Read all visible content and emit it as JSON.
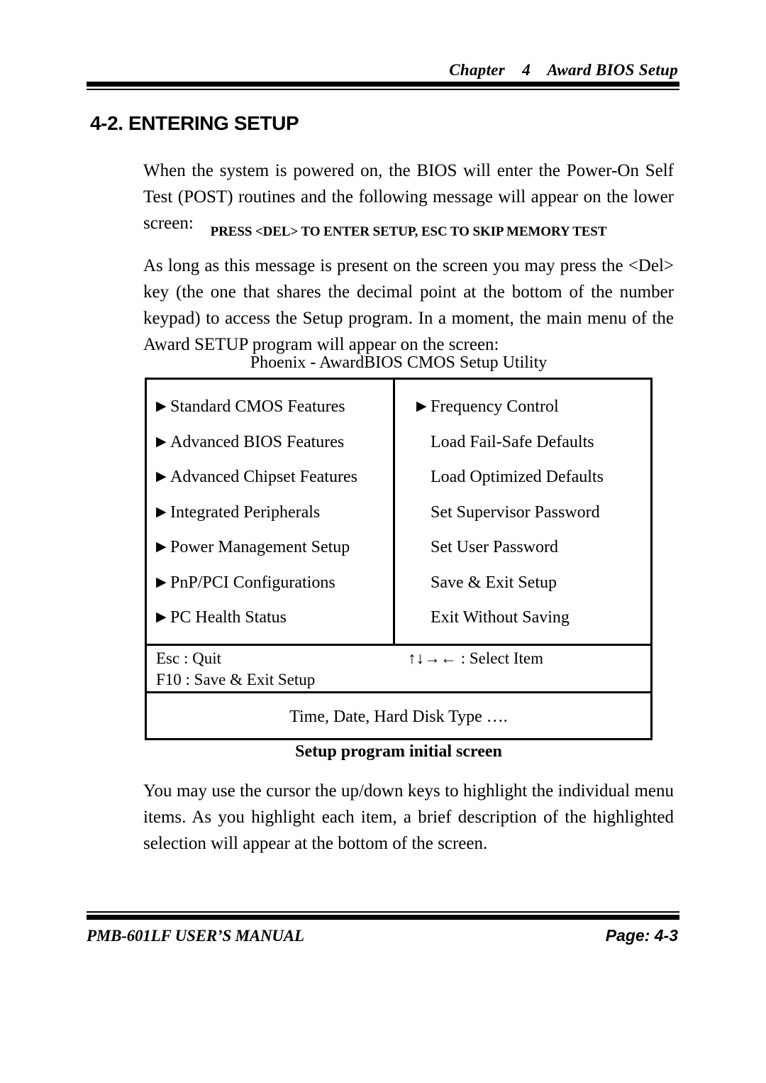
{
  "header": {
    "chapter_label": "Chapter",
    "chapter_number": "4",
    "chapter_title": "Award BIOS Setup",
    "full_title": "Chapter    4    Award BIOS Setup"
  },
  "section": {
    "heading": "4-2. ENTERING SETUP"
  },
  "body": {
    "paragraph_1": "When the system is powered on, the BIOS will enter the Power-On Self Test (POST) routines and the following message will appear on the lower screen:",
    "post_message": "PRESS <DEL> TO ENTER SETUP, ESC TO SKIP MEMORY TEST",
    "paragraph_2": "As long as this message is present on the screen you may press the <Del> key (the one that shares the decimal point at the bottom of the number keypad) to access the Setup program. In a moment, the main menu of the Award SETUP program will appear on the screen:",
    "paragraph_3": "You may use the cursor the up/down keys to highlight the individual menu items. As you highlight each item, a brief description of the highlighted selection will appear at the bottom of the screen."
  },
  "bios_figure": {
    "title": "Phoenix - AwardBIOS CMOS Setup Utility",
    "caption": "Setup program initial screen",
    "left_column": [
      {
        "label": "Standard CMOS Features",
        "has_arrow": true
      },
      {
        "label": "Advanced BIOS Features",
        "has_arrow": true
      },
      {
        "label": "Advanced Chipset Features",
        "has_arrow": true
      },
      {
        "label": "Integrated Peripherals",
        "has_arrow": true
      },
      {
        "label": "Power Management Setup",
        "has_arrow": true
      },
      {
        "label": "PnP/PCI Configurations",
        "has_arrow": true
      },
      {
        "label": "PC Health Status",
        "has_arrow": true
      }
    ],
    "right_column": [
      {
        "label": "Frequency Control",
        "has_arrow": true
      },
      {
        "label": "Load Fail-Safe Defaults",
        "has_arrow": false
      },
      {
        "label": "Load Optimized Defaults",
        "has_arrow": false
      },
      {
        "label": "Set Supervisor Password",
        "has_arrow": false
      },
      {
        "label": "Set User Password",
        "has_arrow": false
      },
      {
        "label": "Save & Exit Setup",
        "has_arrow": false
      },
      {
        "label": "Exit Without Saving",
        "has_arrow": false
      }
    ],
    "arrow_glyph": "▶",
    "key_help": {
      "esc": "Esc : Quit",
      "select": "↑↓→← : Select Item",
      "f10": "F10 : Save & Exit Setup"
    },
    "description_bar": "Time, Date, Hard Disk Type …."
  },
  "footer": {
    "manual_name": "PMB-601LF USER’S MANUAL",
    "page_label": "Page: 4-3"
  }
}
